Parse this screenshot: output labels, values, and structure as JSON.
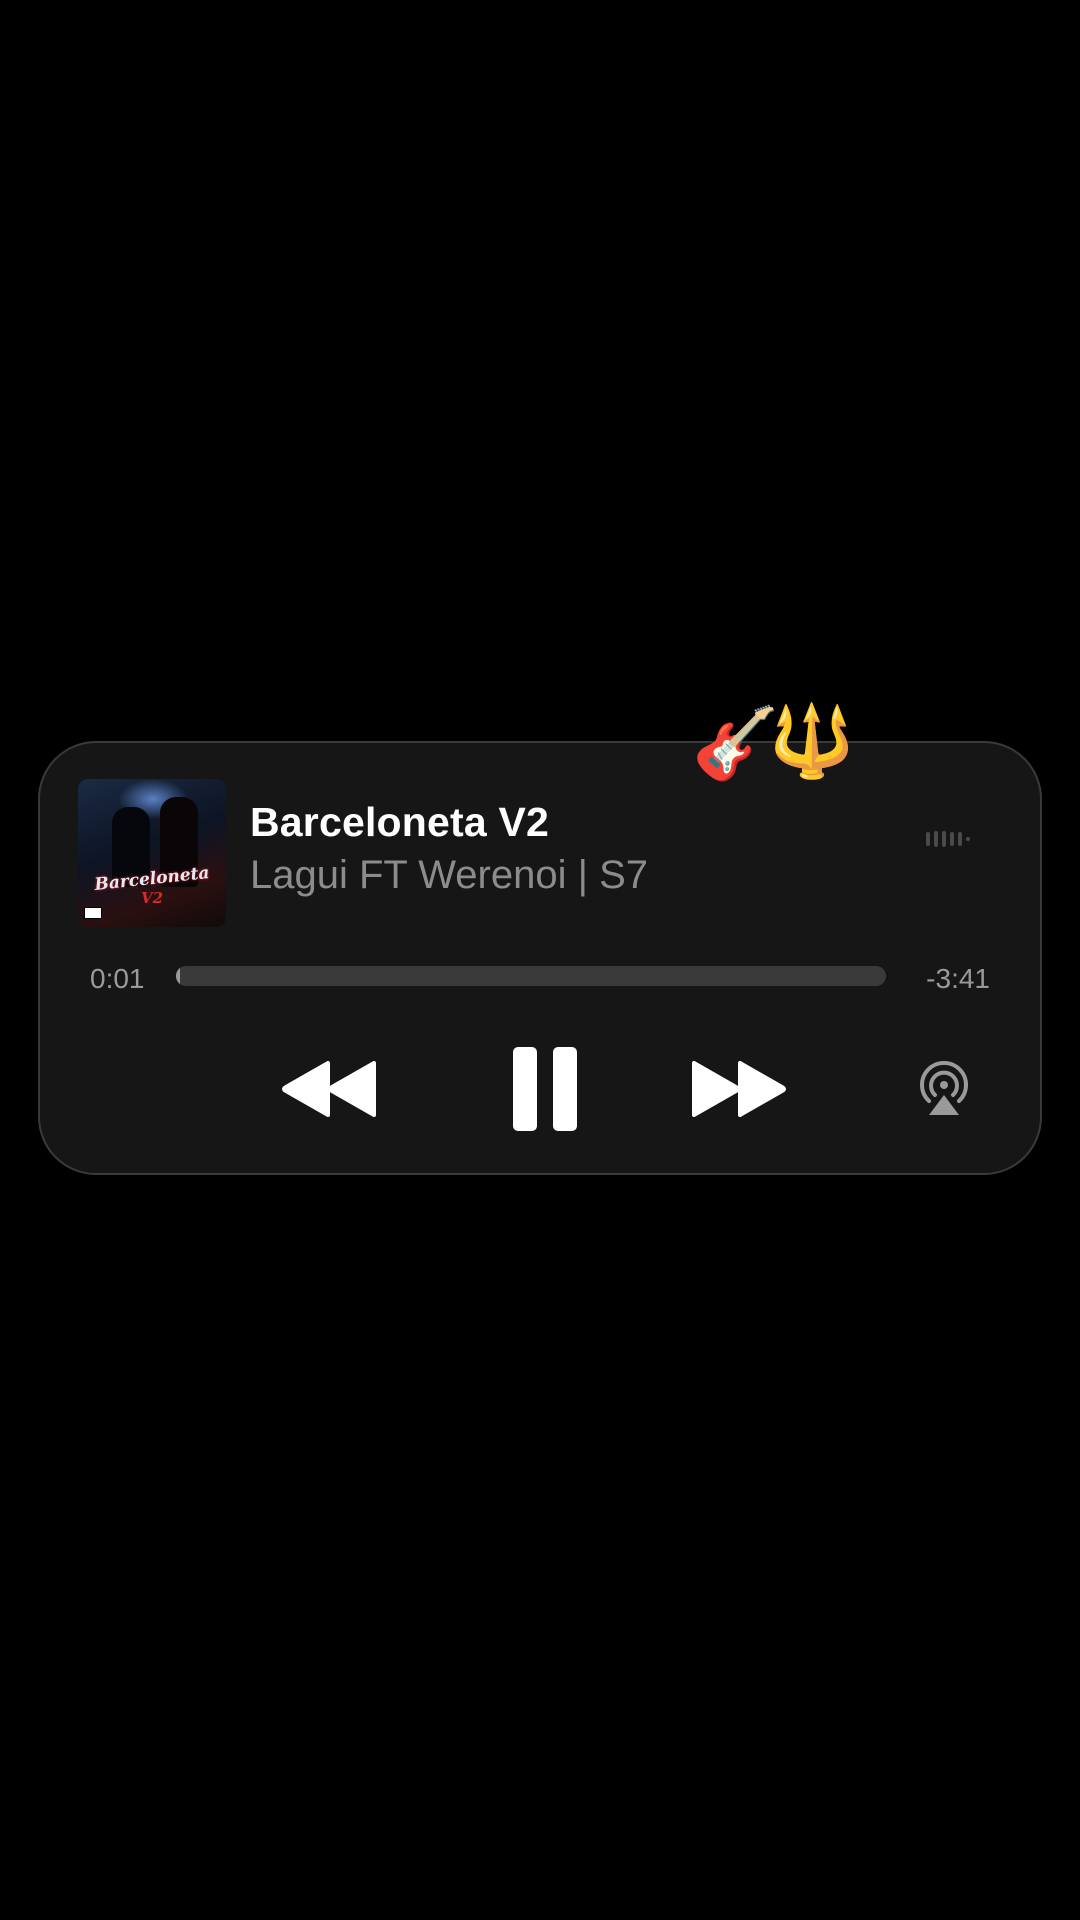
{
  "player": {
    "title": "Barceloneta V2",
    "artist": "Lagui FT Werenoi | S7",
    "elapsed": "0:01",
    "remaining": "-3:41",
    "progress_fraction": 0.005,
    "album_art": {
      "cover_title": "Barceloneta",
      "cover_sub": "V2"
    },
    "controls": {
      "rewind_icon": "rewind-icon",
      "pause_icon": "pause-icon",
      "forward_icon": "fast-forward-icon",
      "airplay_icon": "airplay-icon"
    }
  },
  "stickers": {
    "guitar": "🎸",
    "trident": "🔱"
  },
  "colors": {
    "background": "#000000",
    "card": "#161616",
    "title": "#ffffff",
    "artist": "#8c8c8c",
    "progress_track": "#3a3a3a"
  }
}
